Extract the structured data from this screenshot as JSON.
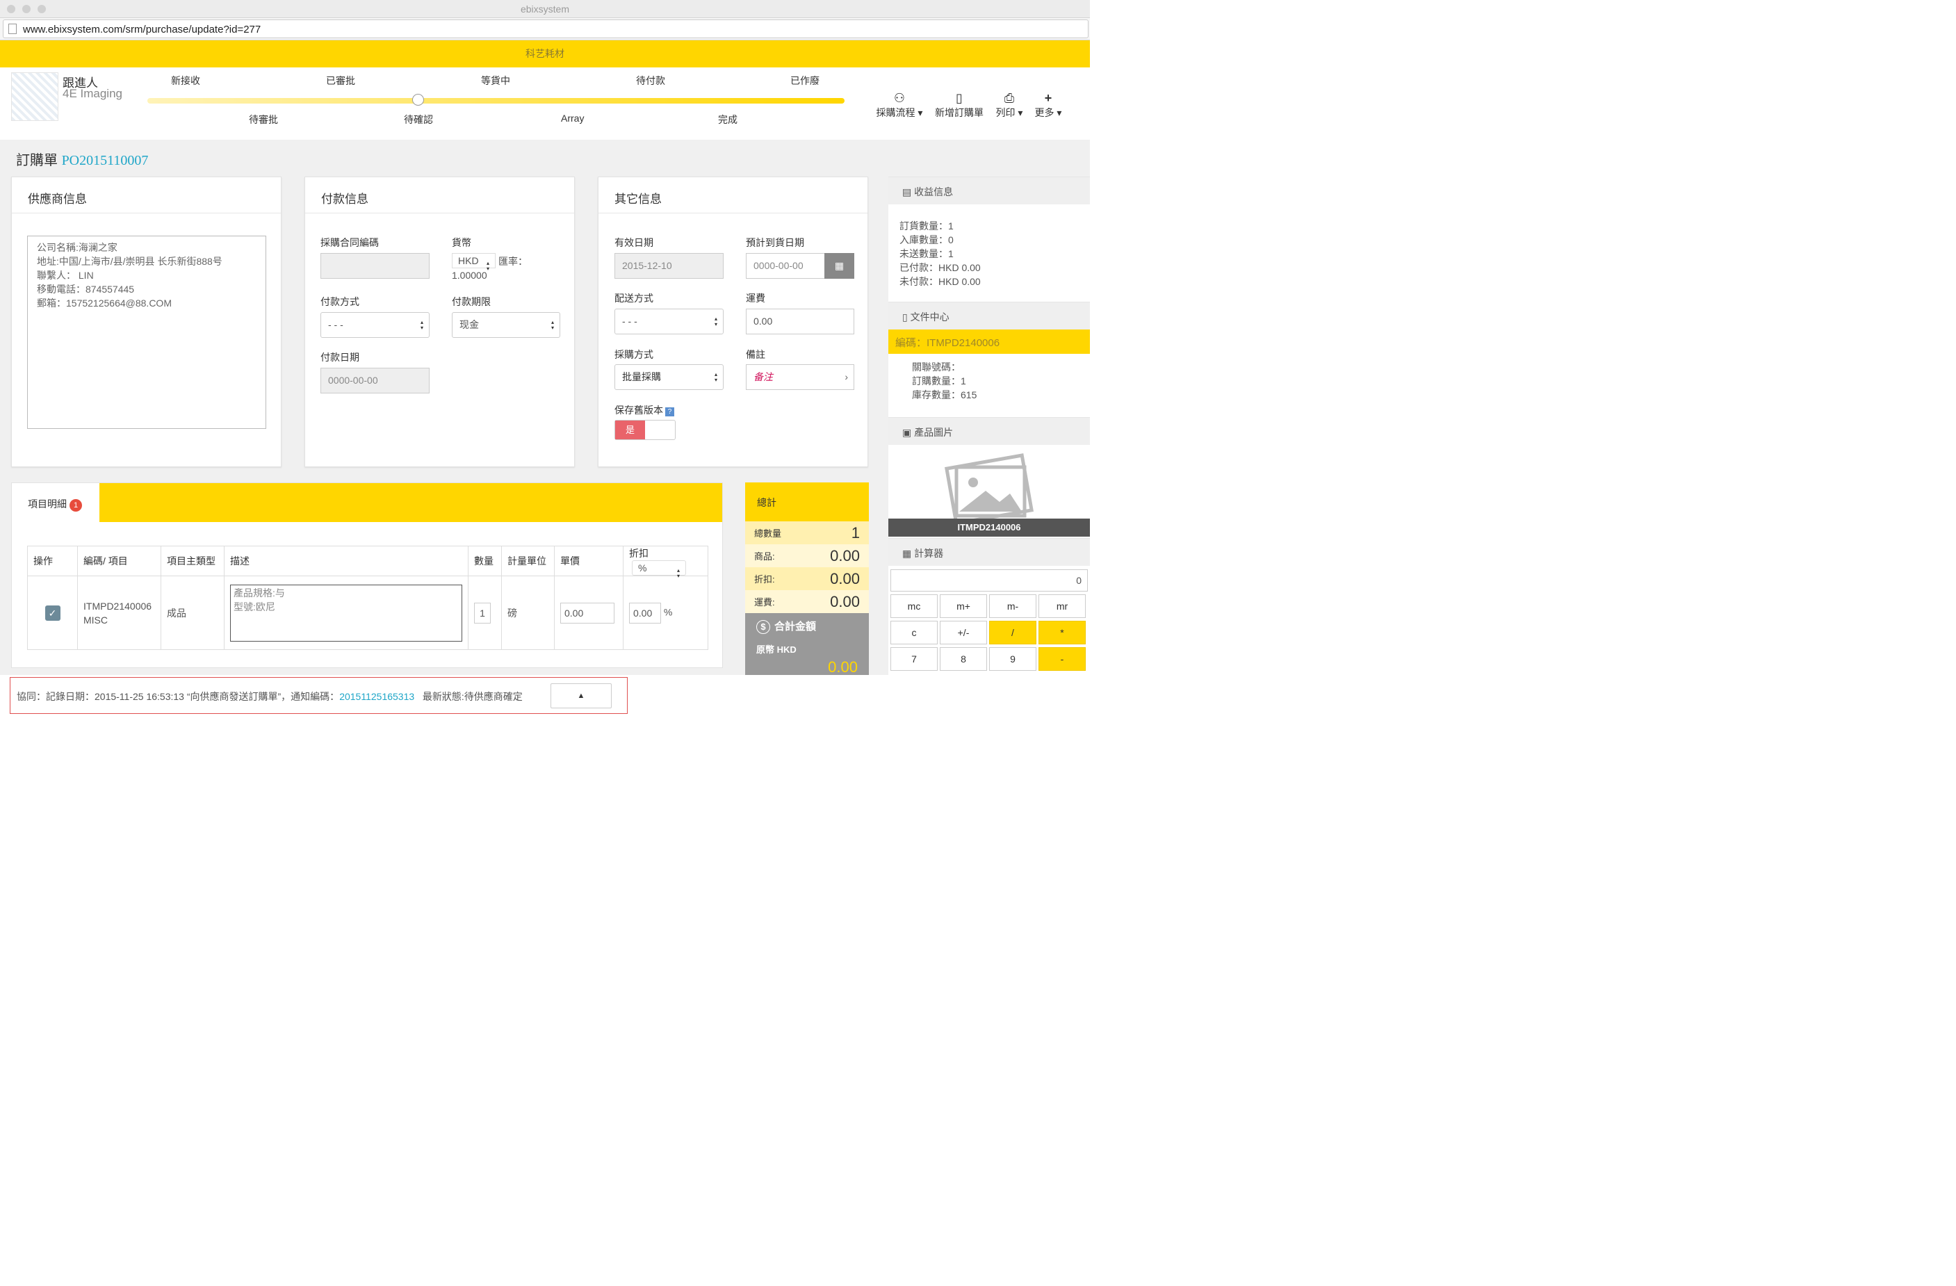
{
  "window": {
    "title": "ebixsystem",
    "url": "www.ebixsystem.com/srm/purchase/update?id=277"
  },
  "banner": "科艺耗材",
  "logo": {
    "line1": "跟進人",
    "line2": "4E Imaging"
  },
  "progress": {
    "top_steps": [
      "新接收",
      "已審批",
      "等貨中",
      "待付款",
      "已作廢"
    ],
    "bottom_steps": [
      "待審批",
      "待確認",
      "Array",
      "完成"
    ],
    "current": "待確認"
  },
  "toolbar": {
    "flow": "採購流程",
    "new_order": "新增訂購單",
    "print": "列印",
    "more": "更多"
  },
  "order": {
    "label": "訂購單",
    "number": "PO2015110007"
  },
  "supplier": {
    "title": "供應商信息",
    "info": "公司名稱:海澜之家\n地址:中国/上海市/县/崇明县 长乐新街888号\n聯繫人： LIN\n移動電話：874557445\n郵箱：15752125664@88.COM"
  },
  "payment": {
    "title": "付款信息",
    "contract_label": "採購合同編碼",
    "contract_value": "",
    "currency_label": "貨幣",
    "currency_value": "HKD",
    "rate_label": "匯率：",
    "rate_value": "1.00000",
    "method_label": "付款方式",
    "method_value": "- - -",
    "term_label": "付款期限",
    "term_value": "现金",
    "date_label": "付款日期",
    "date_value": "0000-00-00"
  },
  "other": {
    "title": "其它信息",
    "valid_label": "有效日期",
    "valid_value": "2015-12-10",
    "eta_label": "預計到貨日期",
    "eta_value": "0000-00-00",
    "delivery_label": "配送方式",
    "delivery_value": "- - -",
    "freight_label": "運費",
    "freight_value": "0.00",
    "purchase_label": "採購方式",
    "purchase_value": "批量採購",
    "remark_label": "備註",
    "remark_value": "备注",
    "keep_label": "保存舊版本",
    "keep_value": "是"
  },
  "income": {
    "title": "收益信息",
    "lines": [
      "訂貨數量：1",
      "入庫數量：0",
      "未送數量：1",
      "已付款：HKD 0.00",
      "未付款：HKD 0.00"
    ]
  },
  "docs": {
    "title": "文件中心",
    "code": "編碼：ITMPD2140006",
    "lines": [
      "關聯號碼：",
      "訂購數量：1",
      "庫存數量：615"
    ]
  },
  "product_image": {
    "title": "產品圖片",
    "caption": "ITMPD2140006"
  },
  "calculator": {
    "title": "計算器",
    "display": "0",
    "rows": [
      [
        "mc",
        "m+",
        "m-",
        "mr"
      ],
      [
        "c",
        "+/-",
        "/",
        "*"
      ],
      [
        "7",
        "8",
        "9",
        "-"
      ]
    ]
  },
  "items": {
    "tab": "項目明細",
    "badge": "1",
    "headers": [
      "操作",
      "編碼/ 項目",
      "項目主類型",
      "描述",
      "數量",
      "計量單位",
      "單價",
      "折扣"
    ],
    "discount_unit": "%",
    "row": {
      "code": "ITMPD2140006",
      "sub": "MISC",
      "type": "成品",
      "desc": "產品規格:与\n型號:欧尼",
      "qty": "1",
      "unit": "磅",
      "price": "0.00",
      "discount": "0.00",
      "pct": "%"
    }
  },
  "totals": {
    "title": "總計",
    "qty_label": "總數量",
    "qty_value": "1",
    "goods_label": "商品:",
    "goods_value": "0.00",
    "disc_label": "折扣:",
    "disc_value": "0.00",
    "freight_label": "運費:",
    "freight_value": "0.00",
    "sum_label": "合計金額",
    "currency": "原幣 HKD",
    "sum_value": "0.00"
  },
  "bottom": {
    "prefix": "協同：記錄日期：2015-11-25 16:53:13 “向供應商發送訂購單”，通知編碼：",
    "code": "20151125165313",
    "status": "最新狀態:待供應商確定"
  }
}
